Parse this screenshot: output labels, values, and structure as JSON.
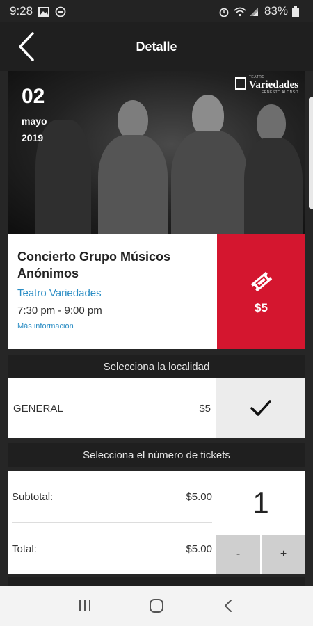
{
  "status_bar": {
    "time": "9:28",
    "battery": "83%"
  },
  "app_bar": {
    "title": "Detalle"
  },
  "hero": {
    "day": "02",
    "month": "mayo",
    "year": "2019",
    "venue_logo": {
      "small": "TEATRO",
      "name": "Variedades",
      "sub": "ERNESTO ALONSO"
    }
  },
  "event": {
    "title": "Concierto Grupo Músicos Anónimos",
    "venue": "Teatro Variedades",
    "time": "7:30 pm - 9:00 pm",
    "more_info": "Más información",
    "price": "$5"
  },
  "locality": {
    "header": "Selecciona la localidad",
    "name": "GENERAL",
    "price": "$5"
  },
  "tickets": {
    "header": "Selecciona el número de tickets",
    "subtotal_label": "Subtotal:",
    "subtotal_value": "$5.00",
    "total_label": "Total:",
    "total_value": "$5.00",
    "quantity": "1",
    "minus_label": "-",
    "plus_label": "+"
  },
  "colors": {
    "accent_red": "#d4162f",
    "link_blue": "#2b8dc4",
    "dark_bg": "#262626"
  }
}
